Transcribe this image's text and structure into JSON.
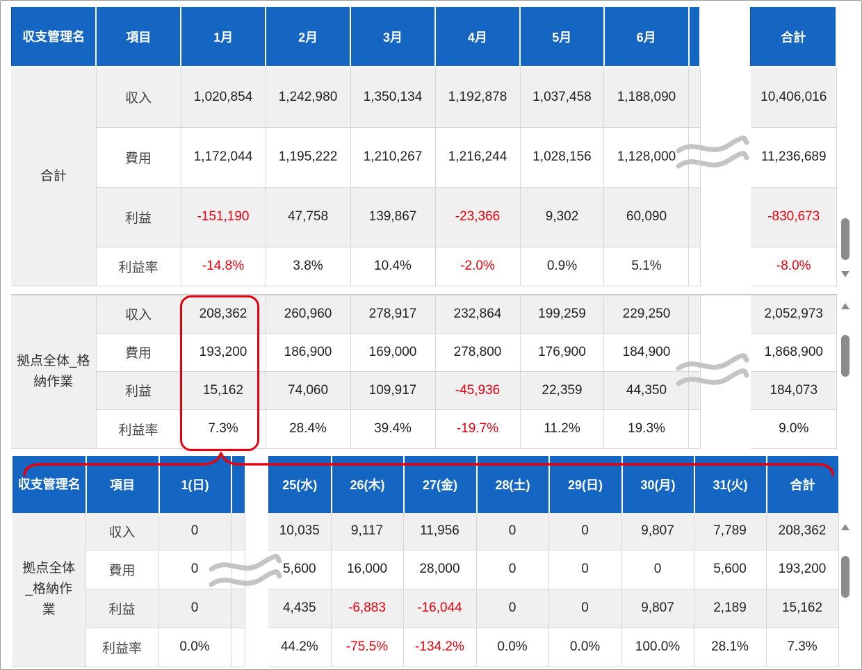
{
  "monthly": {
    "headers": [
      "収支管理名",
      "項目",
      "1月",
      "2月",
      "3月",
      "4月",
      "5月",
      "6月",
      "合計"
    ],
    "group_total": {
      "name": "合計",
      "rows": [
        {
          "label": "収入",
          "values": [
            "1,020,854",
            "1,242,980",
            "1,350,134",
            "1,192,878",
            "1,037,458",
            "1,188,090"
          ],
          "total": "10,406,016",
          "neg": [
            false,
            false,
            false,
            false,
            false,
            false
          ],
          "total_neg": false
        },
        {
          "label": "費用",
          "values": [
            "1,172,044",
            "1,195,222",
            "1,210,267",
            "1,216,244",
            "1,028,156",
            "1,128,000"
          ],
          "total": "11,236,689",
          "neg": [
            false,
            false,
            false,
            false,
            false,
            false
          ],
          "total_neg": false
        },
        {
          "label": "利益",
          "values": [
            "-151,190",
            "47,758",
            "139,867",
            "-23,366",
            "9,302",
            "60,090"
          ],
          "total": "-830,673",
          "neg": [
            true,
            false,
            false,
            true,
            false,
            false
          ],
          "total_neg": true
        },
        {
          "label": "利益率",
          "values": [
            "-14.8%",
            "3.8%",
            "10.4%",
            "-2.0%",
            "0.9%",
            "5.1%"
          ],
          "total": "-8.0%",
          "neg": [
            true,
            false,
            false,
            true,
            false,
            false
          ],
          "total_neg": true
        }
      ]
    },
    "group_base": {
      "name": "拠点全体_格納作業",
      "rows": [
        {
          "label": "収入",
          "values": [
            "208,362",
            "260,960",
            "278,917",
            "232,864",
            "199,259",
            "229,250"
          ],
          "total": "2,052,973",
          "neg": [
            false,
            false,
            false,
            false,
            false,
            false
          ],
          "total_neg": false
        },
        {
          "label": "費用",
          "values": [
            "193,200",
            "186,900",
            "169,000",
            "278,800",
            "176,900",
            "184,900"
          ],
          "total": "1,868,900",
          "neg": [
            false,
            false,
            false,
            false,
            false,
            false
          ],
          "total_neg": false
        },
        {
          "label": "利益",
          "values": [
            "15,162",
            "74,060",
            "109,917",
            "-45,936",
            "22,359",
            "44,350"
          ],
          "total": "184,073",
          "neg": [
            false,
            false,
            false,
            true,
            false,
            false
          ],
          "total_neg": false
        },
        {
          "label": "利益率",
          "values": [
            "7.3%",
            "28.4%",
            "39.4%",
            "-19.7%",
            "11.2%",
            "19.3%"
          ],
          "total": "9.0%",
          "neg": [
            false,
            false,
            false,
            true,
            false,
            false
          ],
          "total_neg": false
        }
      ]
    }
  },
  "daily": {
    "headers_left": [
      "収支管理名",
      "項目",
      "1(日)"
    ],
    "headers_right": [
      "25(水)",
      "26(木)",
      "27(金)",
      "28(土)",
      "29(日)",
      "30(月)",
      "31(火)",
      "合計"
    ],
    "group_name": "拠点全体_格納作業",
    "rows": [
      {
        "label": "収入",
        "day1": "0",
        "values": [
          "10,035",
          "9,117",
          "11,956",
          "0",
          "0",
          "9,807",
          "7,789",
          "208,362"
        ],
        "neg": [
          false,
          false,
          false,
          false,
          false,
          false,
          false,
          false
        ]
      },
      {
        "label": "費用",
        "day1": "0",
        "values": [
          "5,600",
          "16,000",
          "28,000",
          "0",
          "0",
          "0",
          "5,600",
          "193,200"
        ],
        "neg": [
          false,
          false,
          false,
          false,
          false,
          false,
          false,
          false
        ]
      },
      {
        "label": "利益",
        "day1": "0",
        "values": [
          "4,435",
          "-6,883",
          "-16,044",
          "0",
          "0",
          "9,807",
          "2,189",
          "15,162"
        ],
        "neg": [
          false,
          true,
          true,
          false,
          false,
          false,
          false,
          false
        ]
      },
      {
        "label": "利益率",
        "day1": "0.0%",
        "values": [
          "44.2%",
          "-75.5%",
          "-134.2%",
          "0.0%",
          "0.0%",
          "100.0%",
          "28.1%",
          "7.3%"
        ],
        "neg": [
          false,
          true,
          true,
          false,
          false,
          false,
          false,
          false
        ]
      }
    ]
  },
  "colors": {
    "header_bg": "#1466c2",
    "negative": "#e8000c",
    "highlight": "#e8000c",
    "zebra": "#f0f0f0"
  },
  "icons": [
    "scroll-up-arrow",
    "scroll-down-arrow",
    "omission-wave"
  ]
}
